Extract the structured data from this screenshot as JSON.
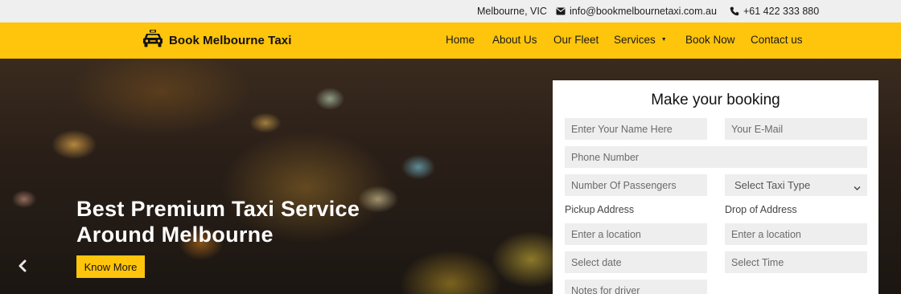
{
  "topbar": {
    "location": "Melbourne, VIC",
    "email": "info@bookmelbournetaxi.com.au",
    "phone": "+61 422 333 880"
  },
  "brand": {
    "name": "Book Melbourne Taxi",
    "accent_color": "#ffc40c"
  },
  "nav": {
    "home": "Home",
    "about": "About Us",
    "fleet": "Our Fleet",
    "services": "Services",
    "book": "Book Now",
    "contact": "Contact us"
  },
  "hero": {
    "title_line1": "Best Premium Taxi Service",
    "title_line2": "Around Melbourne",
    "cta": "Know More"
  },
  "booking": {
    "title": "Make your booking",
    "name_placeholder": "Enter Your Name Here",
    "email_placeholder": "Your E-Mail",
    "phone_placeholder": "Phone Number",
    "passengers_placeholder": "Number Of Passengers",
    "taxi_type_selected": "Select Taxi Type",
    "pickup_label": "Pickup Address",
    "drop_label": "Drop of Address",
    "pickup_placeholder": "Enter a location",
    "drop_placeholder": "Enter a location",
    "date_placeholder": "Select date",
    "time_placeholder": "Select Time",
    "notes_placeholder": "Notes for driver"
  }
}
